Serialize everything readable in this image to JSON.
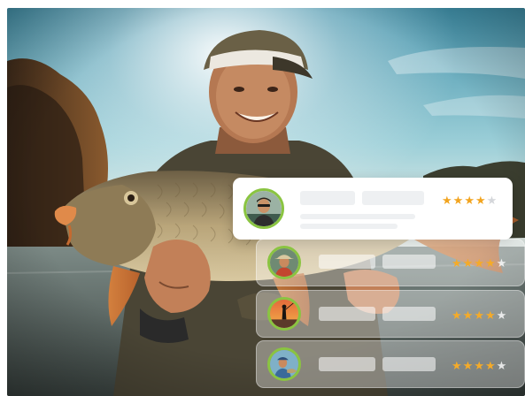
{
  "colors": {
    "accent_ring": "#8ac441",
    "star_filled": "#f2a41f",
    "star_empty": "#d4d6da",
    "card_bg": "#ffffff"
  },
  "reviews": [
    {
      "rating": 4,
      "max": 5,
      "style": "highlighted"
    },
    {
      "rating": 4,
      "max": 5,
      "style": "faded"
    },
    {
      "rating": 4,
      "max": 5,
      "style": "faded"
    },
    {
      "rating": 4,
      "max": 5,
      "style": "faded"
    }
  ],
  "star_glyph": "★"
}
